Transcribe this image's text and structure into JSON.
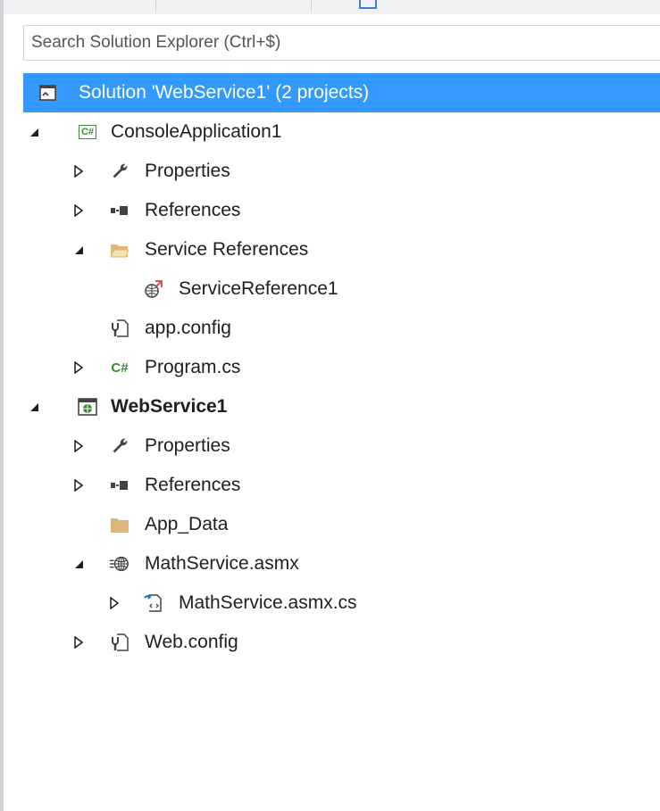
{
  "search": {
    "placeholder": "Search Solution Explorer (Ctrl+$)"
  },
  "tree": [
    {
      "label": "Solution 'WebService1' (2 projects)",
      "icon": "solution-icon",
      "expander": "none",
      "level": 0,
      "selected": true,
      "bold": false
    },
    {
      "label": "ConsoleApplication1",
      "icon": "csharp-project-icon",
      "expander": "expanded",
      "level": 1,
      "selected": false,
      "bold": false
    },
    {
      "label": "Properties",
      "icon": "wrench-icon",
      "expander": "collapsed",
      "level": 2,
      "selected": false,
      "bold": false
    },
    {
      "label": "References",
      "icon": "references-icon",
      "expander": "collapsed",
      "level": 2,
      "selected": false,
      "bold": false
    },
    {
      "label": "Service References",
      "icon": "open-folder-icon",
      "expander": "expanded",
      "level": 2,
      "selected": false,
      "bold": false
    },
    {
      "label": "ServiceReference1",
      "icon": "service-reference-icon",
      "expander": "none",
      "level": 3,
      "selected": false,
      "bold": false
    },
    {
      "label": "app.config",
      "icon": "config-file-icon",
      "expander": "none",
      "level": 2,
      "selected": false,
      "bold": false
    },
    {
      "label": "Program.cs",
      "icon": "csharp-file-icon",
      "expander": "collapsed",
      "level": 2,
      "selected": false,
      "bold": false
    },
    {
      "label": "WebService1",
      "icon": "web-project-icon",
      "expander": "expanded",
      "level": 1,
      "selected": false,
      "bold": true
    },
    {
      "label": "Properties",
      "icon": "wrench-icon",
      "expander": "collapsed",
      "level": 2,
      "selected": false,
      "bold": false
    },
    {
      "label": "References",
      "icon": "references-icon",
      "expander": "collapsed",
      "level": 2,
      "selected": false,
      "bold": false
    },
    {
      "label": "App_Data",
      "icon": "folder-icon",
      "expander": "none",
      "level": 2,
      "selected": false,
      "bold": false
    },
    {
      "label": "MathService.asmx",
      "icon": "web-service-icon",
      "expander": "expanded",
      "level": 2,
      "selected": false,
      "bold": false
    },
    {
      "label": "MathService.asmx.cs",
      "icon": "code-file-icon",
      "expander": "collapsed",
      "level": 3,
      "selected": false,
      "bold": false
    },
    {
      "label": "Web.config",
      "icon": "config-file-icon",
      "expander": "collapsed",
      "level": 2,
      "selected": false,
      "bold": false
    }
  ],
  "colors": {
    "selection": "#3399ff",
    "csharp": "#388a34",
    "folder": "#dcb67a",
    "icon_dark": "#424242",
    "icon_blue": "#1f6fc5"
  }
}
